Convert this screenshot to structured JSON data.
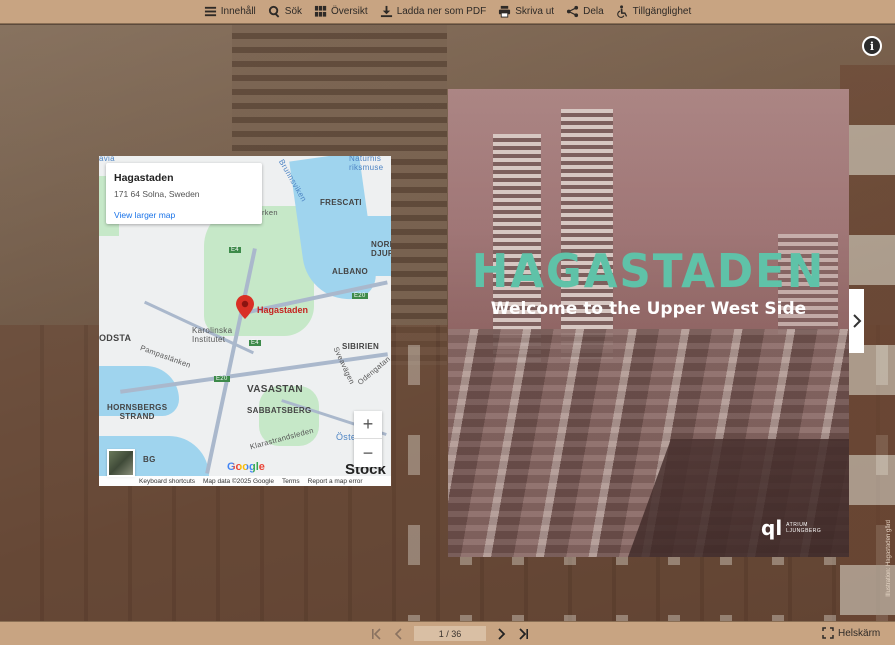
{
  "toolbar": {
    "items": [
      {
        "label": "Innehåll",
        "icon": "menu-icon"
      },
      {
        "label": "Sök",
        "icon": "search-icon"
      },
      {
        "label": "Översikt",
        "icon": "grid-icon"
      },
      {
        "label": "Ladda ner som PDF",
        "icon": "download-icon"
      },
      {
        "label": "Skriva ut",
        "icon": "print-icon"
      },
      {
        "label": "Dela",
        "icon": "share-icon"
      },
      {
        "label": "Tillgänglighet",
        "icon": "accessibility-icon"
      }
    ]
  },
  "info_button": {
    "glyph": "i"
  },
  "map": {
    "card": {
      "title": "Hagastaden",
      "address": "171 64 Solna, Sweden",
      "link": "View larger map"
    },
    "pin_label": "Hagastaden",
    "labels": {
      "frescati": "FRESCATI",
      "albano": "ALBANO",
      "norra_djurg": "NORRA\nDJURG",
      "sibirien": "SIBIRIEN",
      "vasastan": "VASASTAN",
      "sabbatsberg": "SABBATSBERG",
      "hornsbergs": "HORNSBERGS\nSTRAND",
      "odsta": "ODSTA",
      "karolinska": "Karolinska\nInstitutet",
      "pampaslanken": "Pampaslänken",
      "brunnsviken": "Brunnsviken",
      "naturhist": "Naturhis\nriksmuse",
      "odengatan": "Odengatan",
      "sveavagen": "Sveavägen",
      "klarastrand": "Klarastrandsleden",
      "ostermalm": "Öste",
      "arken": "rken",
      "avia": "avia",
      "bg": "BG",
      "e4": "E4",
      "e20": "E20",
      "stock": "Stock"
    },
    "zoom_in": "+",
    "zoom_out": "−",
    "google": "Google",
    "footer": [
      "Keyboard shortcuts",
      "Map data ©2025 Google",
      "Terms",
      "Report a map error"
    ]
  },
  "cover": {
    "title": "HAGASTADEN",
    "subtitle": "Welcome to the Upper West Side",
    "logo_mark": "ql",
    "logo_text": "ATRIUM\nLJUNGBERG",
    "title_color": "#5fc2a8"
  },
  "side_credit": "Illustration: Hagastaden gård",
  "pager": {
    "page_value": "1 / 36"
  },
  "fullscreen_label": "Helskärm",
  "colors": {
    "toolbar_bg": "#c8a482",
    "pin": "#d93025",
    "link": "#1a73e8"
  }
}
